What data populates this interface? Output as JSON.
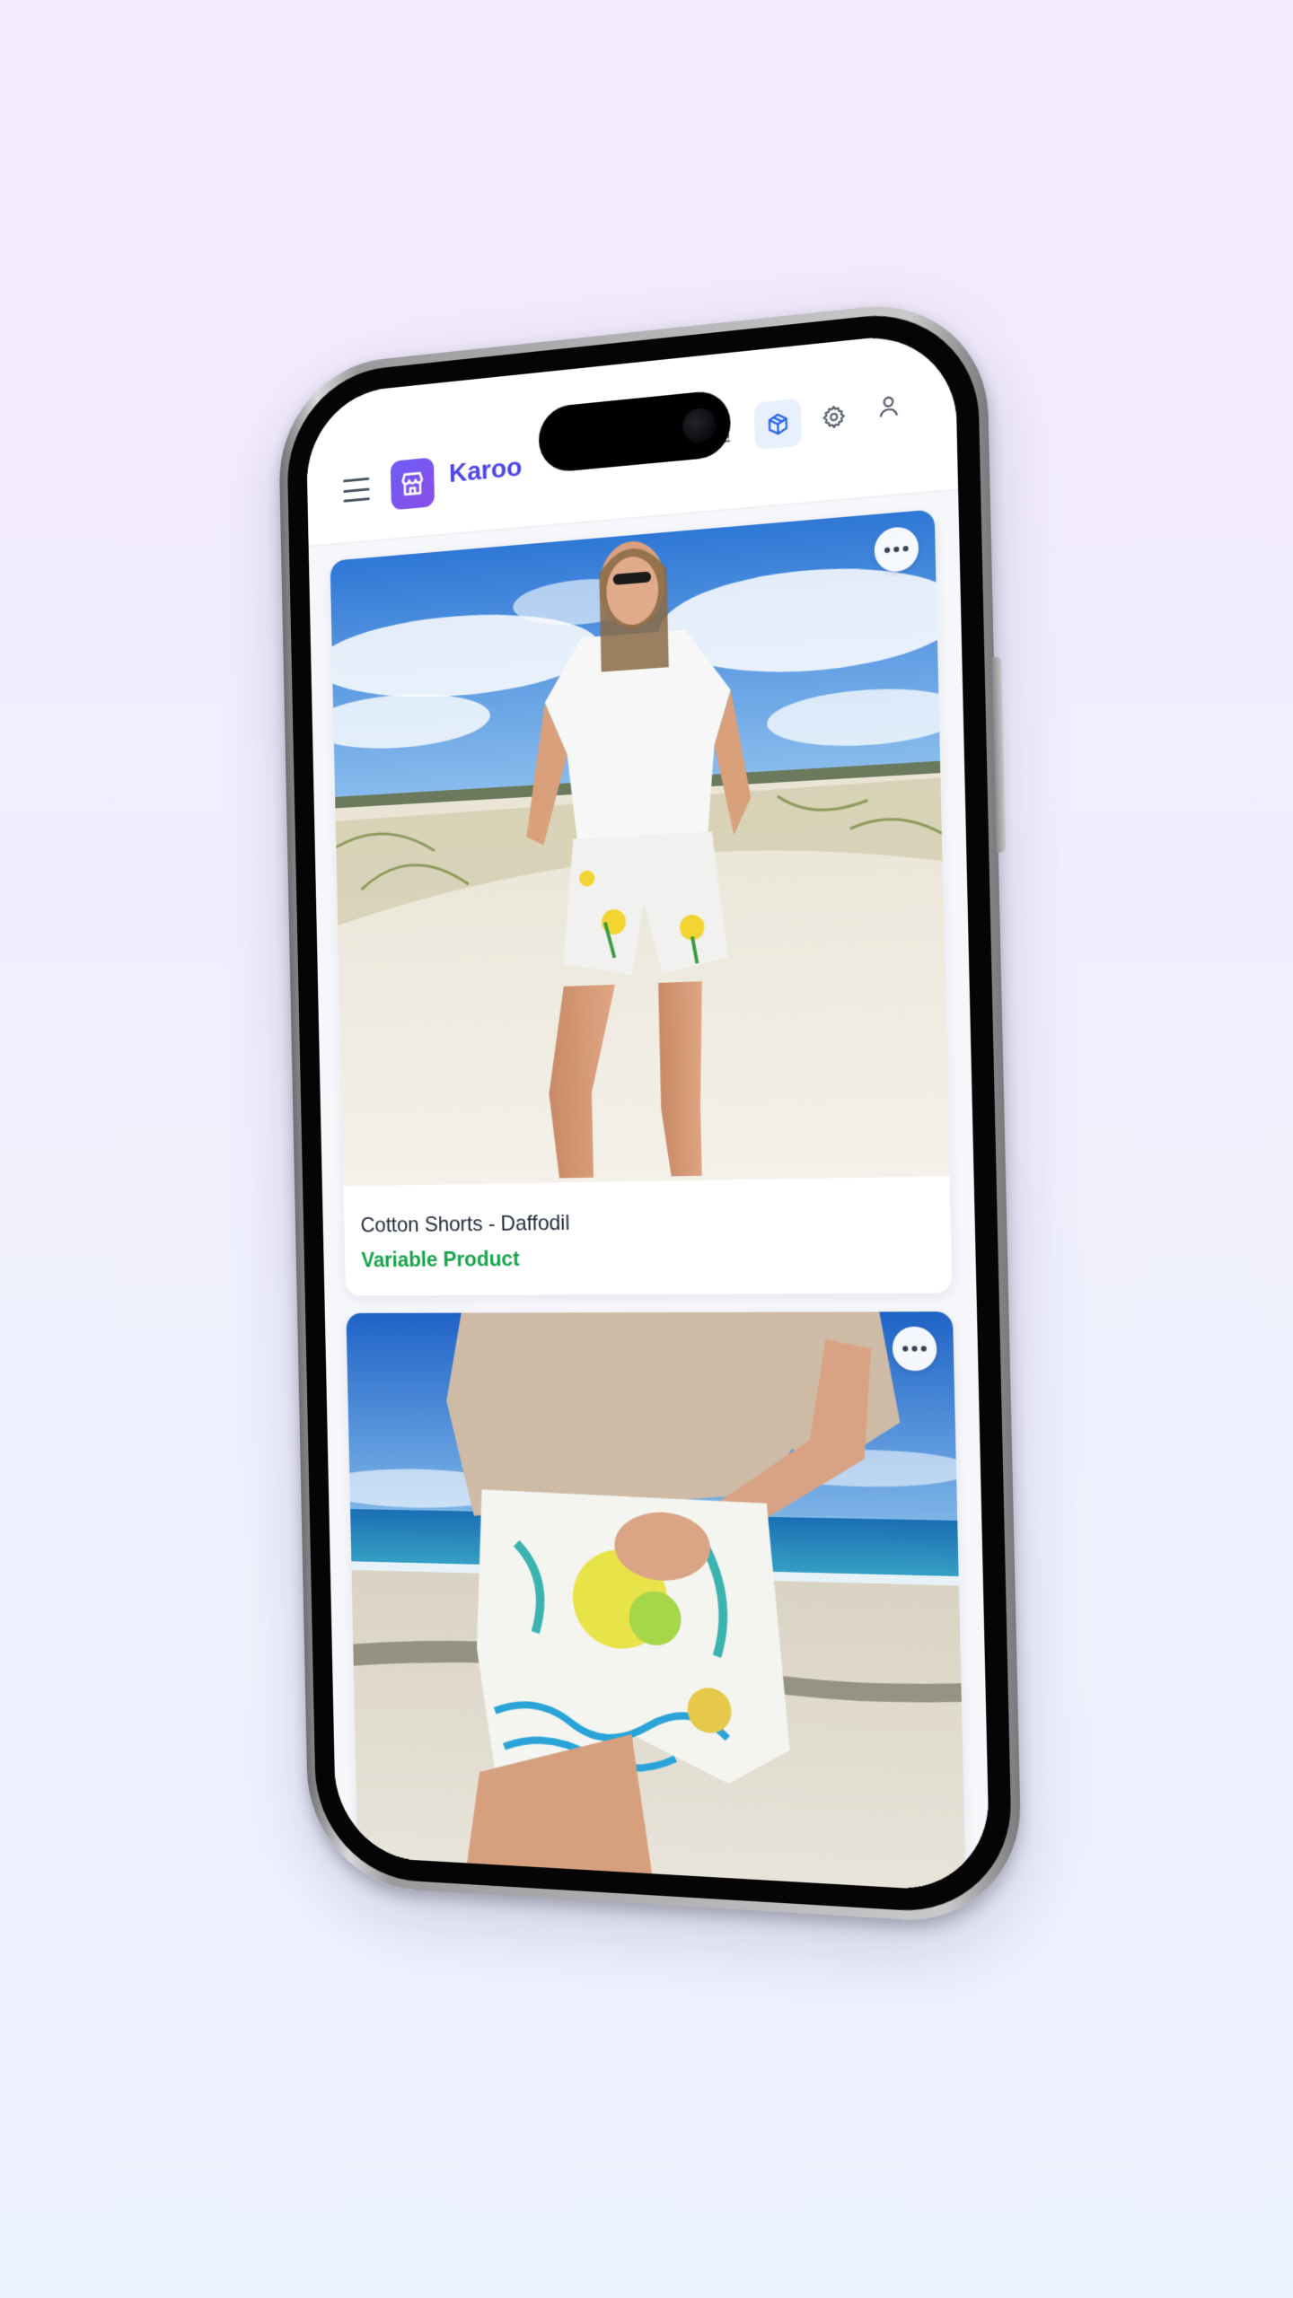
{
  "header": {
    "brand": "Karoo"
  },
  "products": [
    {
      "title": "Cotton Shorts - Daffodil",
      "type": "Variable Product"
    },
    {
      "title": "",
      "type": ""
    }
  ],
  "icons": {
    "menu": "menu-icon",
    "logo": "store-icon",
    "analytics": "bar-chart-icon",
    "products": "box-icon",
    "settings": "gear-icon",
    "account": "user-icon",
    "more": "more-dots-icon"
  },
  "colors": {
    "brand": "#4f46e5",
    "logo_gradient_start": "#6d5ef5",
    "logo_gradient_end": "#8b4de8",
    "active_tab_bg": "#e8effd",
    "product_type": "#16a34a"
  }
}
